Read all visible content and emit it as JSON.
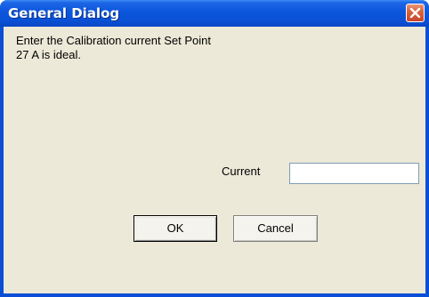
{
  "window": {
    "title": "General Dialog",
    "close_icon": "close-icon"
  },
  "message": {
    "line1": "Enter the Calibration current Set Point",
    "line2": "27 A is ideal."
  },
  "current_field": {
    "label": "Current",
    "value": "",
    "placeholder": ""
  },
  "buttons": {
    "ok_label": "OK",
    "cancel_label": "Cancel"
  },
  "colors": {
    "titlebar": "#0b56dc",
    "close_button": "#d9643e",
    "client_background": "#ece9d8"
  }
}
